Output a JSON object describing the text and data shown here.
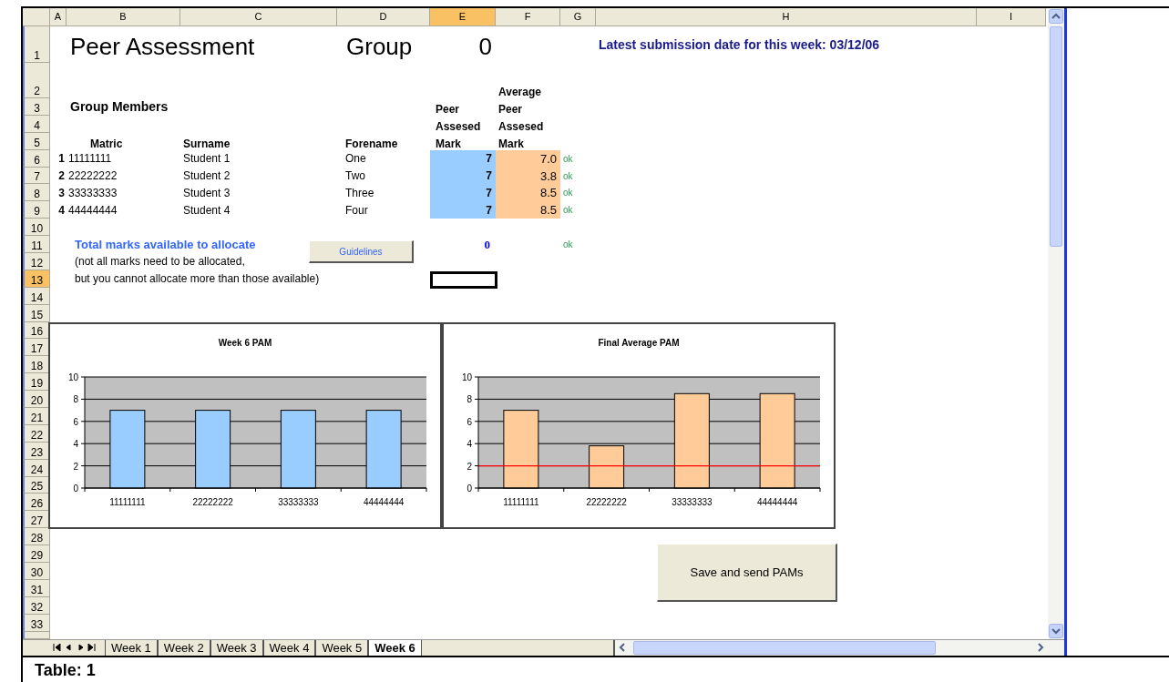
{
  "sheet": {
    "columns": [
      {
        "label": "A",
        "selected": false
      },
      {
        "label": "B",
        "selected": false
      },
      {
        "label": "C",
        "selected": false
      },
      {
        "label": "D",
        "selected": false
      },
      {
        "label": "E",
        "selected": true
      },
      {
        "label": "F",
        "selected": false
      },
      {
        "label": "G",
        "selected": false
      },
      {
        "label": "H",
        "selected": false
      },
      {
        "label": "I",
        "selected": false
      }
    ],
    "rows": [
      {
        "label": "1",
        "selected": false
      },
      {
        "label": "2",
        "selected": false
      },
      {
        "label": "3",
        "selected": false
      },
      {
        "label": "4",
        "selected": false
      },
      {
        "label": "5",
        "selected": false
      },
      {
        "label": "6",
        "selected": false
      },
      {
        "label": "7",
        "selected": false
      },
      {
        "label": "8",
        "selected": false
      },
      {
        "label": "9",
        "selected": false
      },
      {
        "label": "10",
        "selected": false
      },
      {
        "label": "11",
        "selected": false
      },
      {
        "label": "12",
        "selected": false
      },
      {
        "label": "13",
        "selected": true
      },
      {
        "label": "14",
        "selected": false
      },
      {
        "label": "15",
        "selected": false
      },
      {
        "label": "16",
        "selected": false
      },
      {
        "label": "17",
        "selected": false
      },
      {
        "label": "18",
        "selected": false
      },
      {
        "label": "19",
        "selected": false
      },
      {
        "label": "20",
        "selected": false
      },
      {
        "label": "21",
        "selected": false
      },
      {
        "label": "22",
        "selected": false
      },
      {
        "label": "23",
        "selected": false
      },
      {
        "label": "24",
        "selected": false
      },
      {
        "label": "25",
        "selected": false
      },
      {
        "label": "26",
        "selected": false
      },
      {
        "label": "27",
        "selected": false
      },
      {
        "label": "28",
        "selected": false
      },
      {
        "label": "29",
        "selected": false
      },
      {
        "label": "30",
        "selected": false
      },
      {
        "label": "31",
        "selected": false
      },
      {
        "label": "32",
        "selected": false
      },
      {
        "label": "33",
        "selected": false
      }
    ]
  },
  "title": "Peer Assessment",
  "group_label": "Group",
  "group_number": "0",
  "deadline": "Latest submission date for this week: 03/12/06",
  "members_heading": "Group Members",
  "member_columns": {
    "matric": "Matric",
    "surname": "Surname",
    "forename": "Forename",
    "peer_mark": [
      "Peer",
      "Assesed",
      "Mark"
    ],
    "average_mark": [
      "Average",
      "Peer",
      "Assesed",
      "Mark"
    ]
  },
  "members": [
    {
      "index": "1",
      "matric": "11111111",
      "surname": "Student 1",
      "forename": "One",
      "peer_mark": "7",
      "average_mark": "7.0",
      "status": "ok"
    },
    {
      "index": "2",
      "matric": "22222222",
      "surname": "Student 2",
      "forename": "Two",
      "peer_mark": "7",
      "average_mark": "3.8",
      "status": "ok"
    },
    {
      "index": "3",
      "matric": "33333333",
      "surname": "Student 3",
      "forename": "Three",
      "peer_mark": "7",
      "average_mark": "8.5",
      "status": "ok"
    },
    {
      "index": "4",
      "matric": "44444444",
      "surname": "Student 4",
      "forename": "Four",
      "peer_mark": "7",
      "average_mark": "8.5",
      "status": "ok"
    }
  ],
  "total": {
    "label": "Total marks available to allocate",
    "value": "0",
    "status": "ok",
    "notes": [
      "(not all marks need to be allocated,",
      "but you cannot allocate more than those available)"
    ]
  },
  "guidelines_button": "Guidelines",
  "save_button": "Save and send PAMs",
  "charts": [
    {
      "chart_data": {
        "type": "bar",
        "title": "Week 6 PAM",
        "categories": [
          "11111111",
          "22222222",
          "33333333",
          "44444444"
        ],
        "series": [
          {
            "color": "#99ccff",
            "values": [
              7,
              7,
              7,
              7
            ]
          }
        ],
        "ylim": [
          0,
          10
        ],
        "yticks": [
          0,
          2,
          4,
          6,
          8,
          10
        ],
        "grid": true
      }
    },
    {
      "chart_data": {
        "type": "bar",
        "title": "Final Average PAM",
        "categories": [
          "11111111",
          "22222222",
          "33333333",
          "44444444"
        ],
        "series": [
          {
            "color": "#ffcc99",
            "values": [
              7.0,
              3.8,
              8.5,
              8.5
            ]
          }
        ],
        "ylim": [
          0,
          10
        ],
        "yticks": [
          0,
          2,
          4,
          6,
          8,
          10
        ],
        "grid": true,
        "ref_lines": [
          {
            "axis": "y",
            "value": 2,
            "color": "#ff0000"
          }
        ]
      }
    }
  ],
  "sheet_tabs": [
    {
      "label": "Week 1",
      "selected": false
    },
    {
      "label": "Week 2",
      "selected": false
    },
    {
      "label": "Week 3",
      "selected": false
    },
    {
      "label": "Week 4",
      "selected": false
    },
    {
      "label": "Week 5",
      "selected": false
    },
    {
      "label": "Week 6",
      "selected": true
    }
  ],
  "caption": "Table: 1"
}
